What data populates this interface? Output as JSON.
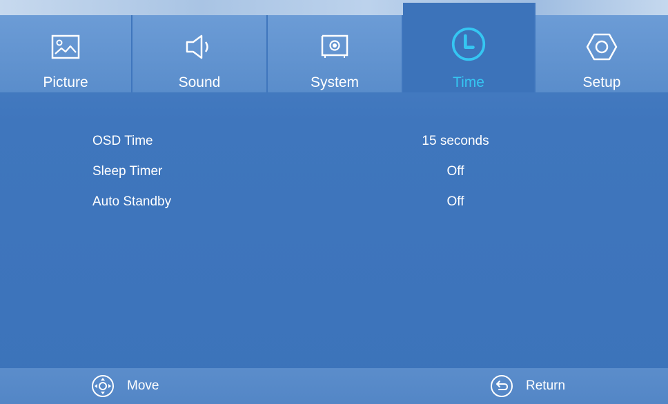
{
  "tabs": [
    {
      "label": "Picture",
      "icon": "picture-icon",
      "active": false
    },
    {
      "label": "Sound",
      "icon": "speaker-icon",
      "active": false
    },
    {
      "label": "System",
      "icon": "system-icon",
      "active": false
    },
    {
      "label": "Time",
      "icon": "clock-icon",
      "active": true
    },
    {
      "label": "Setup",
      "icon": "hexagon-nut-icon",
      "active": false
    }
  ],
  "settings": [
    {
      "label": "OSD Time",
      "value": "15 seconds"
    },
    {
      "label": "Sleep Timer",
      "value": "Off"
    },
    {
      "label": "Auto Standby",
      "value": "Off"
    }
  ],
  "footer": {
    "move_label": "Move",
    "move_icon": "dpad-icon",
    "return_label": "Return",
    "return_icon": "return-arrow-icon"
  },
  "colors": {
    "background": "#3c73ba",
    "tab_inactive": "#5a8dcb",
    "active_accent": "#35c6f2",
    "text": "#ffffff"
  }
}
